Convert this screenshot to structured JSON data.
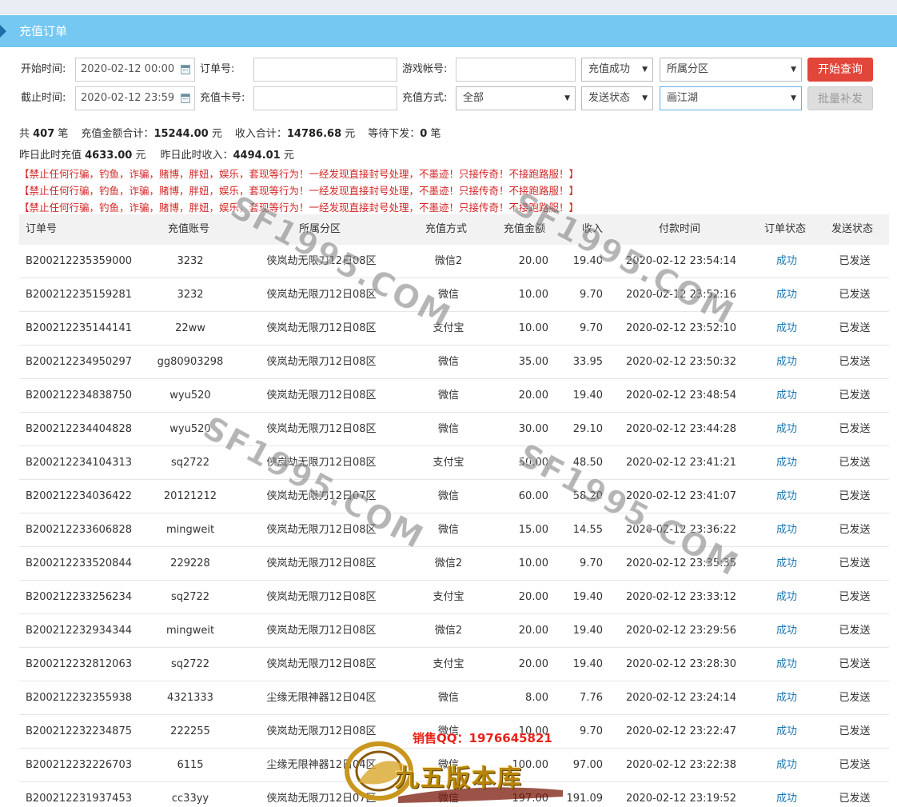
{
  "page_title": "充值订单",
  "filters": {
    "start_label": "开始时间:",
    "start_value": "2020-02-12 00:00",
    "end_label": "截止时间:",
    "end_value": "2020-02-12 23:59",
    "order_label": "订单号:",
    "order_value": "",
    "card_label": "充值卡号:",
    "card_value": "",
    "account_label": "游戏帐号:",
    "account_value": "",
    "method_label": "充值方式:",
    "method_value": "全部",
    "recharge_status_value": "充值成功",
    "send_status_value": "发送状态",
    "zone_value": "所属分区",
    "server_value": "画江湖",
    "search_button": "开始查询",
    "resend_button": "批量补发"
  },
  "summary": {
    "line1": [
      {
        "label": "共 ",
        "value": "407",
        "suffix": " 笔"
      },
      {
        "label": "充值金额合计：",
        "value": "15244.00",
        "suffix": " 元"
      },
      {
        "label": "收入合计：",
        "value": "14786.68",
        "suffix": " 元"
      },
      {
        "label": "等待下发：",
        "value": "0",
        "suffix": " 笔"
      }
    ],
    "line2": [
      {
        "label": "昨日此时充值 ",
        "value": "4633.00",
        "suffix": " 元"
      },
      {
        "label": "昨日此时收入：",
        "value": "4494.01",
        "suffix": " 元"
      }
    ]
  },
  "warnings": [
    "【禁止任何行骗，钓鱼，诈骗，赌博，胖妞，娱乐，套现等行为！一经发现直接封号处理，不墨迹！只接传奇！不接跑路服！】",
    "【禁止任何行骗，钓鱼，诈骗，赌博，胖妞，娱乐，套现等行为！一经发现直接封号处理，不墨迹！只接传奇！不接跑路服！】",
    "【禁止任何行骗，钓鱼，诈骗，赌博，胖妞，娱乐，套现等行为！一经发现直接封号处理，不墨迹！只接传奇！不接跑路服！】"
  ],
  "table": {
    "columns": [
      "订单号",
      "充值账号",
      "所属分区",
      "充值方式",
      "充值金额",
      "收入",
      "付款时间",
      "订单状态",
      "发送状态"
    ],
    "rows": [
      [
        "B200212235359000",
        "3232",
        "侠岚劫无限刀12日08区",
        "微信2",
        "20.00",
        "19.40",
        "2020-02-12 23:54:14",
        "成功",
        "已发送"
      ],
      [
        "B200212235159281",
        "3232",
        "侠岚劫无限刀12日08区",
        "微信",
        "10.00",
        "9.70",
        "2020-02-12 23:52:16",
        "成功",
        "已发送"
      ],
      [
        "B200212235144141",
        "22ww",
        "侠岚劫无限刀12日08区",
        "支付宝",
        "10.00",
        "9.70",
        "2020-02-12 23:52:10",
        "成功",
        "已发送"
      ],
      [
        "B200212234950297",
        "gg80903298",
        "侠岚劫无限刀12日08区",
        "微信",
        "35.00",
        "33.95",
        "2020-02-12 23:50:32",
        "成功",
        "已发送"
      ],
      [
        "B200212234838750",
        "wyu520",
        "侠岚劫无限刀12日08区",
        "微信",
        "20.00",
        "19.40",
        "2020-02-12 23:48:54",
        "成功",
        "已发送"
      ],
      [
        "B200212234404828",
        "wyu520",
        "侠岚劫无限刀12日08区",
        "微信",
        "30.00",
        "29.10",
        "2020-02-12 23:44:28",
        "成功",
        "已发送"
      ],
      [
        "B200212234104313",
        "sq2722",
        "侠岚劫无限刀12日08区",
        "支付宝",
        "50.00",
        "48.50",
        "2020-02-12 23:41:21",
        "成功",
        "已发送"
      ],
      [
        "B200212234036422",
        "20121212",
        "侠岚劫无限刀12日07区",
        "微信",
        "60.00",
        "58.20",
        "2020-02-12 23:41:07",
        "成功",
        "已发送"
      ],
      [
        "B200212233606828",
        "mingweit",
        "侠岚劫无限刀12日08区",
        "微信",
        "15.00",
        "14.55",
        "2020-02-12 23:36:22",
        "成功",
        "已发送"
      ],
      [
        "B200212233520844",
        "229228",
        "侠岚劫无限刀12日08区",
        "微信2",
        "10.00",
        "9.70",
        "2020-02-12 23:35:35",
        "成功",
        "已发送"
      ],
      [
        "B200212233256234",
        "sq2722",
        "侠岚劫无限刀12日08区",
        "支付宝",
        "20.00",
        "19.40",
        "2020-02-12 23:33:12",
        "成功",
        "已发送"
      ],
      [
        "B200212232934344",
        "mingweit",
        "侠岚劫无限刀12日08区",
        "微信2",
        "20.00",
        "19.40",
        "2020-02-12 23:29:56",
        "成功",
        "已发送"
      ],
      [
        "B200212232812063",
        "sq2722",
        "侠岚劫无限刀12日08区",
        "支付宝",
        "20.00",
        "19.40",
        "2020-02-12 23:28:30",
        "成功",
        "已发送"
      ],
      [
        "B200212232355938",
        "4321333",
        "尘缘无限神器12日04区",
        "微信",
        "8.00",
        "7.76",
        "2020-02-12 23:24:14",
        "成功",
        "已发送"
      ],
      [
        "B200212232234875",
        "222255",
        "侠岚劫无限刀12日08区",
        "微信",
        "10.00",
        "9.70",
        "2020-02-12 23:22:47",
        "成功",
        "已发送"
      ],
      [
        "B200212232226703",
        "6115",
        "尘缘无限神器12日04区",
        "微信",
        "100.00",
        "97.00",
        "2020-02-12 23:22:38",
        "成功",
        "已发送"
      ],
      [
        "B200212231937453",
        "cc33yy",
        "侠岚劫无限刀12日07区",
        "微信",
        "197.00",
        "191.09",
        "2020-02-12 23:19:52",
        "成功",
        "已发送"
      ]
    ]
  },
  "watermark_text": "SF1995.COM",
  "promo": {
    "qq": "销售QQ：1976645821",
    "brand": "九五版本库"
  }
}
